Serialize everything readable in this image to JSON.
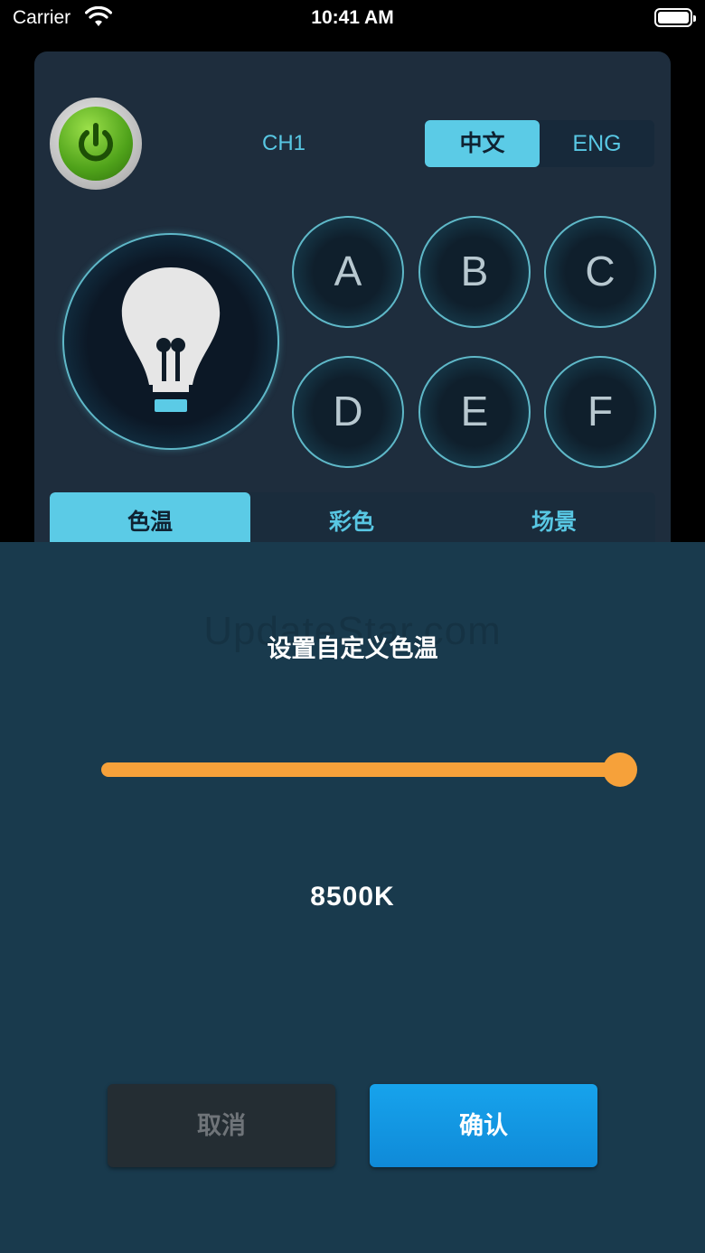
{
  "status_bar": {
    "carrier": "Carrier",
    "time": "10:41 AM"
  },
  "header": {
    "channel": "CH1",
    "lang_zh": "中文",
    "lang_en": "ENG",
    "active_lang": "中文"
  },
  "scene_buttons": [
    "A",
    "B",
    "C",
    "D",
    "E",
    "F"
  ],
  "mode_tabs": {
    "items": [
      "色温",
      "彩色",
      "场景"
    ],
    "active": "色温"
  },
  "sheet": {
    "watermark": "UpdateStar.com",
    "title": "设置自定义色温",
    "slider": {
      "value": 1.0
    },
    "value_text": "8500K",
    "cancel_label": "取消",
    "confirm_label": "确认"
  },
  "colors": {
    "accent": "#5bcbe6",
    "slider": "#f6a13a",
    "confirm": "#0f8ad8",
    "power": "#4fa21a"
  },
  "icons": [
    "wifi-icon",
    "battery-icon",
    "power-icon",
    "bulb-icon"
  ]
}
